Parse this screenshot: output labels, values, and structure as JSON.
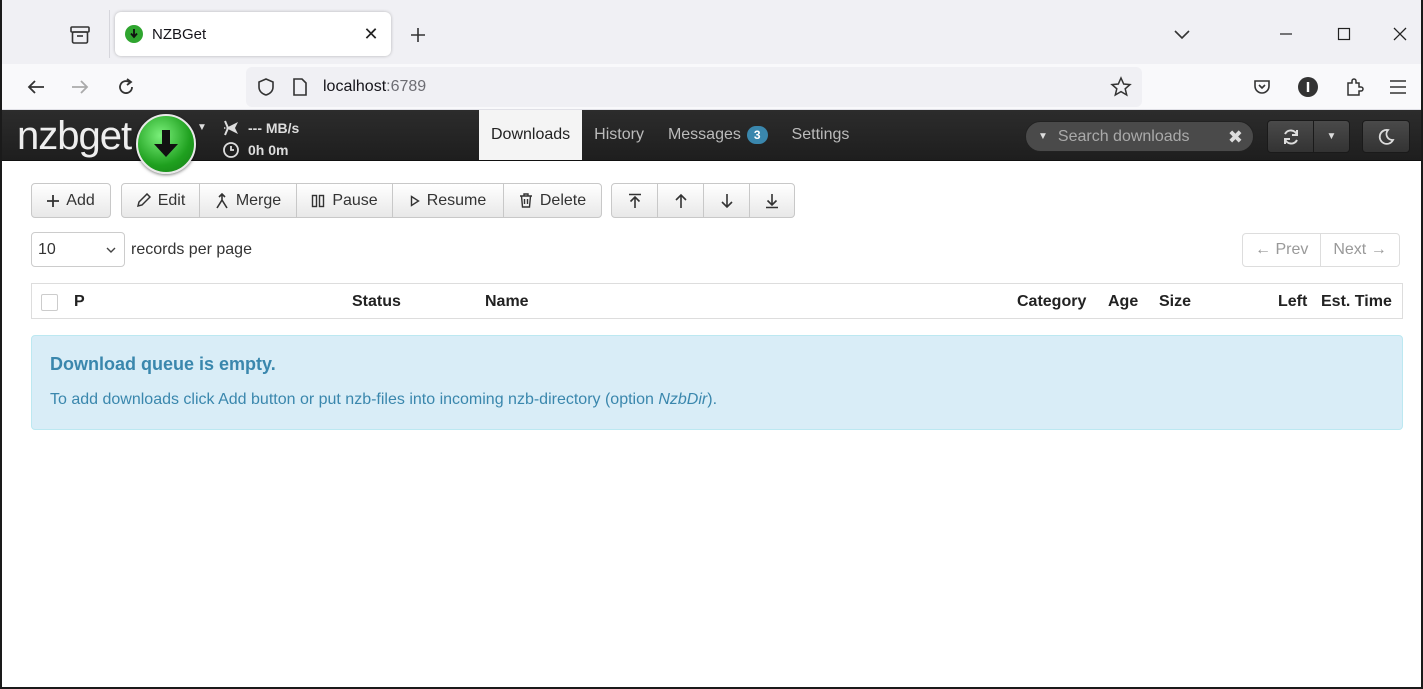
{
  "browser": {
    "tab_title": "NZBGet",
    "url_host": "localhost",
    "url_port": ":6789"
  },
  "app": {
    "logo_text": "nzbget",
    "speed": "--- MB/s",
    "time_left": "0h 0m",
    "nav": {
      "downloads": "Downloads",
      "history": "History",
      "messages": "Messages",
      "messages_count": "3",
      "settings": "Settings"
    },
    "search_placeholder": "Search downloads"
  },
  "toolbar": {
    "add": "Add",
    "edit": "Edit",
    "merge": "Merge",
    "pause": "Pause",
    "resume": "Resume",
    "delete": "Delete"
  },
  "paging": {
    "per_page_value": "10",
    "per_page_label": "records per page",
    "prev": "← Prev",
    "next": "Next →"
  },
  "table": {
    "headers": {
      "p": "P",
      "status": "Status",
      "name": "Name",
      "category": "Category",
      "age": "Age",
      "size": "Size",
      "left": "Left",
      "est_time": "Est. Time"
    }
  },
  "empty": {
    "title": "Download queue is empty.",
    "text_before": "To add downloads click Add button or put nzb-files into incoming nzb-directory (option ",
    "option": "NzbDir",
    "text_after": ")."
  },
  "colors": {
    "accent": "#3a87ad",
    "alert_bg": "#d9edf7",
    "header_bg": "#222222",
    "logo_green": "#2fa52f"
  }
}
